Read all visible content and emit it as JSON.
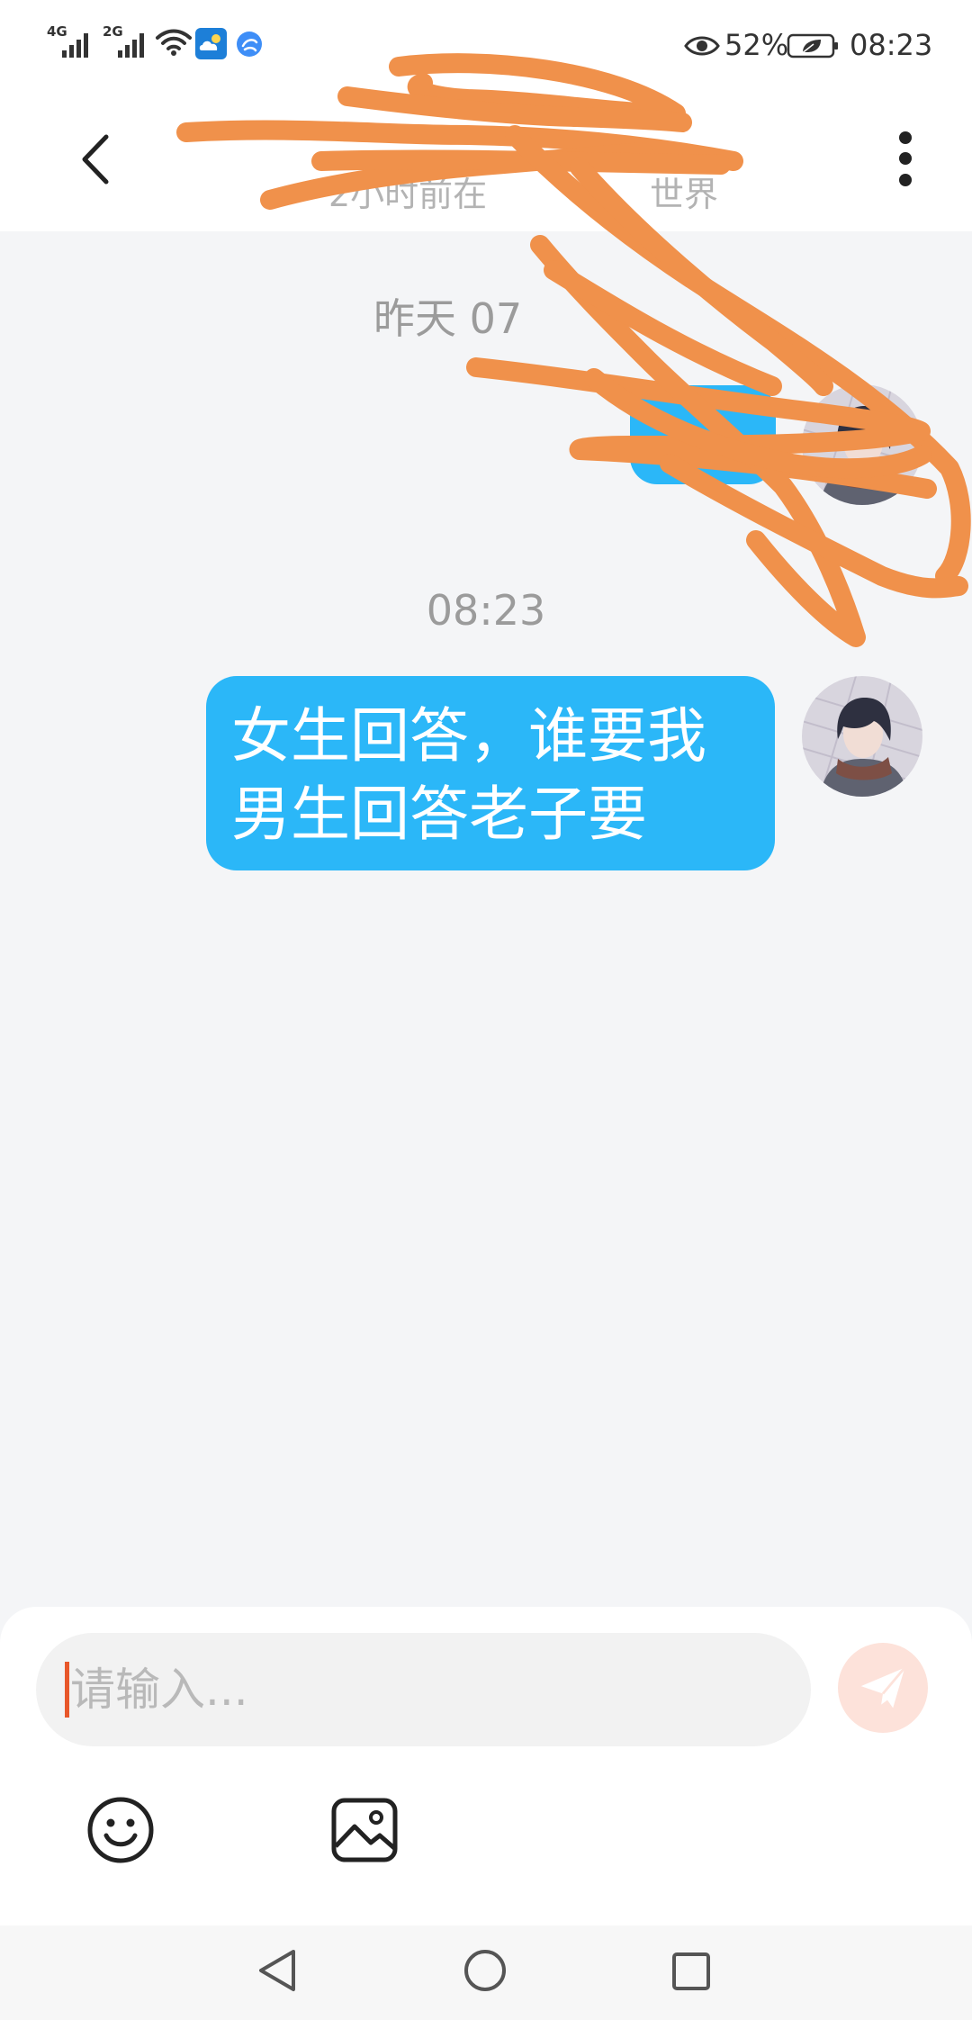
{
  "status_bar": {
    "network_1": "4G",
    "network_2": "2G",
    "battery_percent": "52%",
    "time": "08:23"
  },
  "header": {
    "subtitle_visible_start": "2小时前在",
    "subtitle_visible_end": "世界"
  },
  "chat": {
    "earlier_timestamp_visible": "昨天 07",
    "timestamp": "08:23",
    "messages": [
      {
        "text": "女生回答，谁要我\n男生回答老子要"
      }
    ]
  },
  "composer": {
    "placeholder": "请输入..."
  },
  "icons": {
    "back": "back-arrow-icon",
    "menu": "more-vertical-icon",
    "send": "paper-plane-icon",
    "emoji": "smiley-icon",
    "image": "image-icon",
    "nav_back": "nav-back-icon",
    "nav_home": "nav-home-icon",
    "nav_recents": "nav-recents-icon",
    "status": [
      "signal-icon",
      "wifi-icon",
      "weather-app-icon",
      "browser-app-icon",
      "eye-icon",
      "battery-icon"
    ]
  },
  "colors": {
    "bubble": "#2bb7f8",
    "redaction_scribble": "#f0914b",
    "send_button": "#fde2da",
    "cursor": "#e8572a",
    "chat_background": "#f4f5f7"
  }
}
